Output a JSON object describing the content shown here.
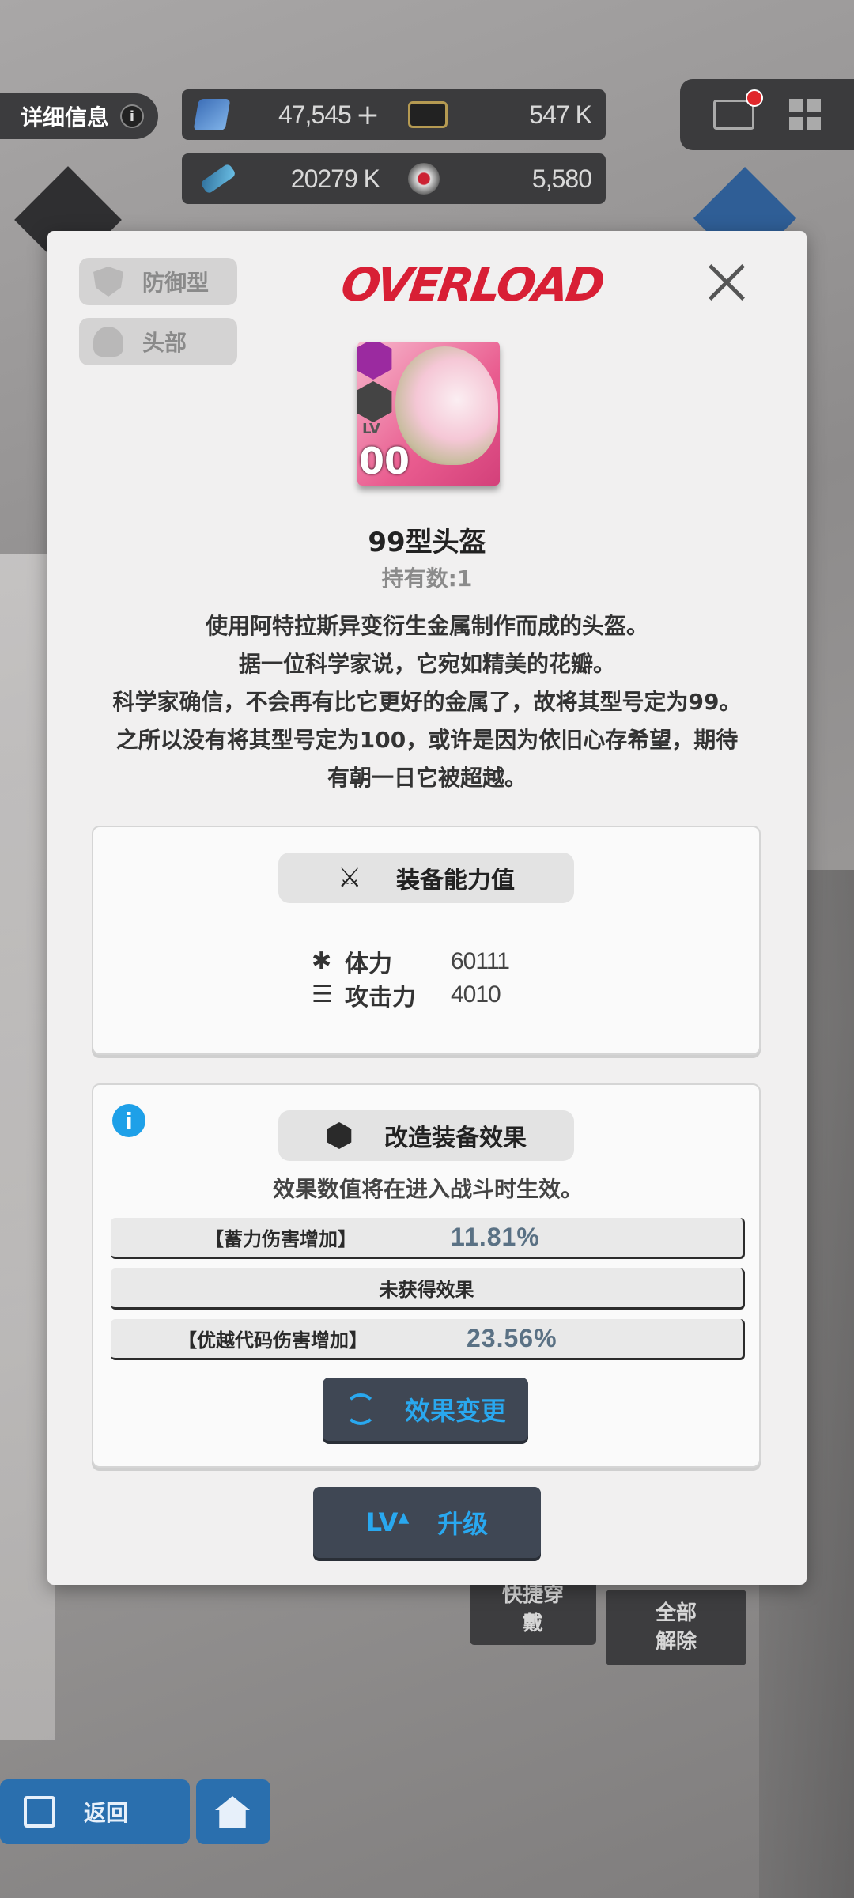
{
  "hud": {
    "detail_label": "详细信息",
    "info_symbol": "i",
    "resources": [
      {
        "icon": "gem-icon",
        "value": "47,545",
        "plus": "+"
      },
      {
        "icon": "credit-card-icon",
        "value": "547 K"
      },
      {
        "icon": "battery-icon",
        "value": "20279 K"
      },
      {
        "icon": "core-orb-icon",
        "value": "5,580"
      }
    ]
  },
  "modal": {
    "type_tag": "防御型",
    "slot_tag": "头部",
    "brand": "OVERLOAD",
    "item": {
      "level_label": "LV",
      "level_value": "00",
      "name": "99型头盔",
      "count_label": "持有数:1"
    },
    "description": [
      "使用阿特拉斯异变衍生金属制作而成的头盔。",
      "据一位科学家说，它宛如精美的花瓣。",
      "科学家确信，不会再有比它更好的金属了，故将其型号定为99。",
      "之所以没有将其型号定为100，或许是因为依旧心存希望，期待",
      "有朝一日它被超越。"
    ],
    "stats_panel": {
      "title": "装备能力值",
      "stats": [
        {
          "name": "体力",
          "value": "60111",
          "icon": "asterisk-icon"
        },
        {
          "name": "攻击力",
          "value": "4010",
          "icon": "bullets-icon"
        }
      ]
    },
    "effects_panel": {
      "title": "改造装备效果",
      "note": "效果数值将在进入战斗时生效。",
      "effects": [
        {
          "name": "【蓄力伤害增加】",
          "value": "11.81%"
        },
        {
          "name": "未获得效果",
          "value": ""
        },
        {
          "name": "【优越代码伤害增加】",
          "value": "23.56%"
        }
      ],
      "change_button": "效果变更"
    },
    "upgrade_button": {
      "lv": "LV",
      "label": "升级"
    }
  },
  "background": {
    "quick_equip": "快捷穿戴",
    "unequip_all": "全部解除",
    "back_label": "返回"
  },
  "colors": {
    "brand_red": "#d81f35",
    "accent_blue": "#29a8ef",
    "info_blue": "#1ea0e8",
    "dark_button": "#3f4754"
  }
}
